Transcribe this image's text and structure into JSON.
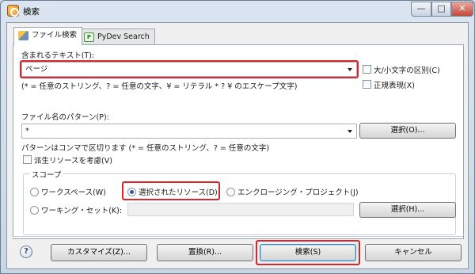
{
  "window": {
    "title": "検索",
    "controls": {
      "minimize": "—",
      "maximize": "□",
      "close": "✕"
    }
  },
  "tabs": [
    {
      "label": "ファイル検索",
      "icon": "file-search-icon",
      "active": true
    },
    {
      "label": "PyDev Search",
      "icon": "pydev-icon",
      "active": false
    }
  ],
  "containing_text": {
    "label": "含まれるテキスト(T):",
    "value": "ページ",
    "case_sensitive_label": "大/小文字の区別(C)",
    "regex_label": "正規表現(X)",
    "hint": "(* = 任意のストリング、? = 任意の文字、¥ = リテラル * ? ¥ のエスケープ文字)"
  },
  "file_name_patterns": {
    "label": "ファイル名のパターン(P):",
    "value": "*",
    "choose_button": "選択(O)...",
    "hint": "パターンはコンマで区切ります (* = 任意のストリング、? = 任意の文字)",
    "derived_label": "派生リソースを考慮(V)"
  },
  "scope": {
    "title": "スコープ",
    "workspace": "ワークスペース(W)",
    "selected_resources": "選択されたリソース(D)",
    "enclosing_projects": "エンクロージング・プロジェクト(J)",
    "working_set": "ワーキング・セット(K):",
    "choose_button": "選択(H)...",
    "selected": "selected_resources"
  },
  "buttons": {
    "help": "?",
    "customize": "カスタマイズ(Z)...",
    "replace": "置換(R)...",
    "search": "検索(S)",
    "cancel": "キャンセル"
  },
  "colors": {
    "highlight": "#d9262b"
  }
}
